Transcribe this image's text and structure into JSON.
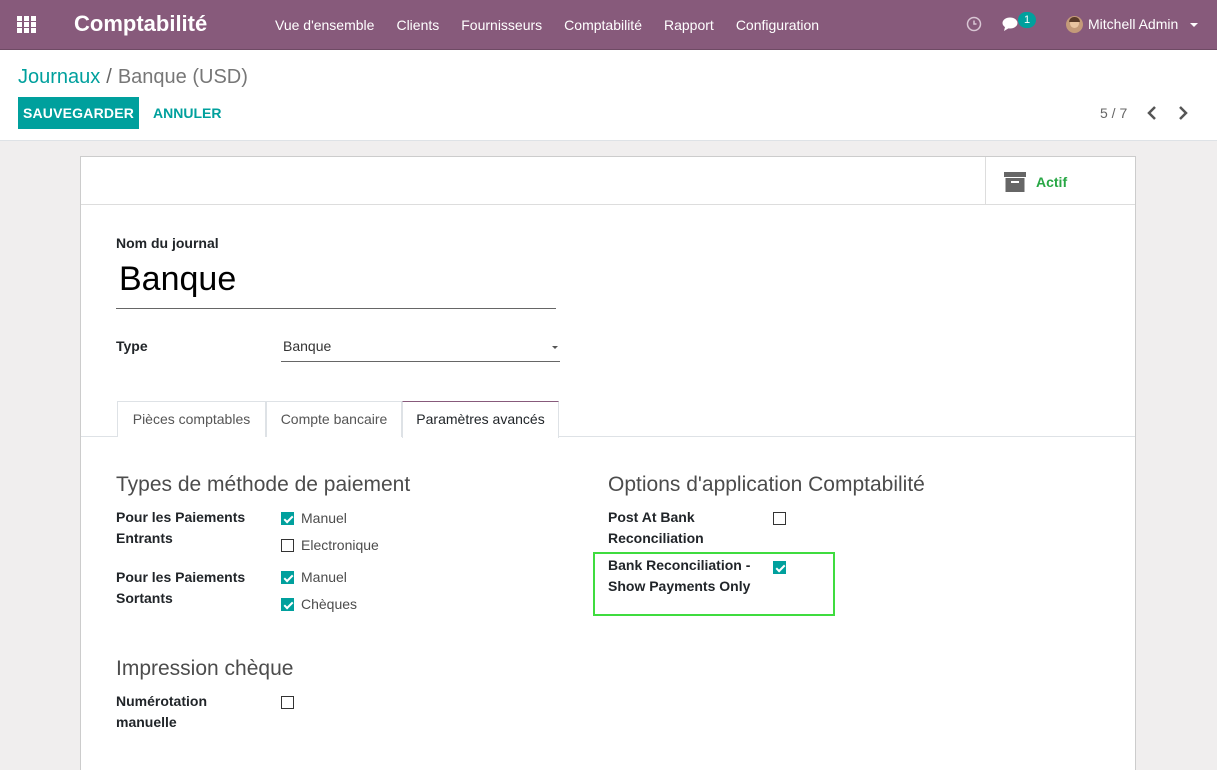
{
  "navbar": {
    "app_title": "Comptabilité",
    "menu": [
      "Vue d'ensemble",
      "Clients",
      "Fournisseurs",
      "Comptabilité",
      "Rapport",
      "Configuration"
    ],
    "chat_count": "1",
    "user_name": "Mitchell Admin",
    "icons": [
      "apps-grid-icon",
      "clock-icon",
      "chat-icon",
      "avatar",
      "caret-down-icon"
    ],
    "bg_color": "#875a7b"
  },
  "control_panel": {
    "breadcrumb": {
      "parent": "Journaux",
      "separator": "/",
      "current": "Banque (USD)"
    },
    "save_label": "SAUVEGARDER",
    "cancel_label": "ANNULER",
    "pager": "5 / 7"
  },
  "form": {
    "active_label": "Actif",
    "journal_name_label": "Nom du journal",
    "journal_name": "Banque",
    "type_label": "Type",
    "type_value": "Banque",
    "tabs": [
      "Pièces comptables",
      "Compte bancaire",
      "Paramètres avancés"
    ],
    "active_tab": "Paramètres avancés",
    "payment_methods": {
      "title": "Types de méthode de paiement",
      "incoming_label": "Pour les Paiements Entrants",
      "incoming": [
        {
          "label": "Manuel",
          "checked": true
        },
        {
          "label": "Electronique",
          "checked": false
        }
      ],
      "outgoing_label": "Pour les Paiements Sortants",
      "outgoing": [
        {
          "label": "Manuel",
          "checked": true
        },
        {
          "label": "Chèques",
          "checked": true
        }
      ]
    },
    "accounting_options": {
      "title": "Options d'application Comptabilité",
      "post_at_bank_label": "Post At Bank Reconciliation",
      "post_at_bank_checked": false,
      "show_payments_label": "Bank Reconciliation - Show Payments Only",
      "show_payments_checked": true
    },
    "check_printing": {
      "title": "Impression chèque",
      "manual_numbering_label": "Numérotation manuelle",
      "manual_numbering_checked": false
    }
  },
  "colors": {
    "accent": "#00a09d",
    "active_green": "#28a745",
    "highlight": "#3fdc3f"
  }
}
